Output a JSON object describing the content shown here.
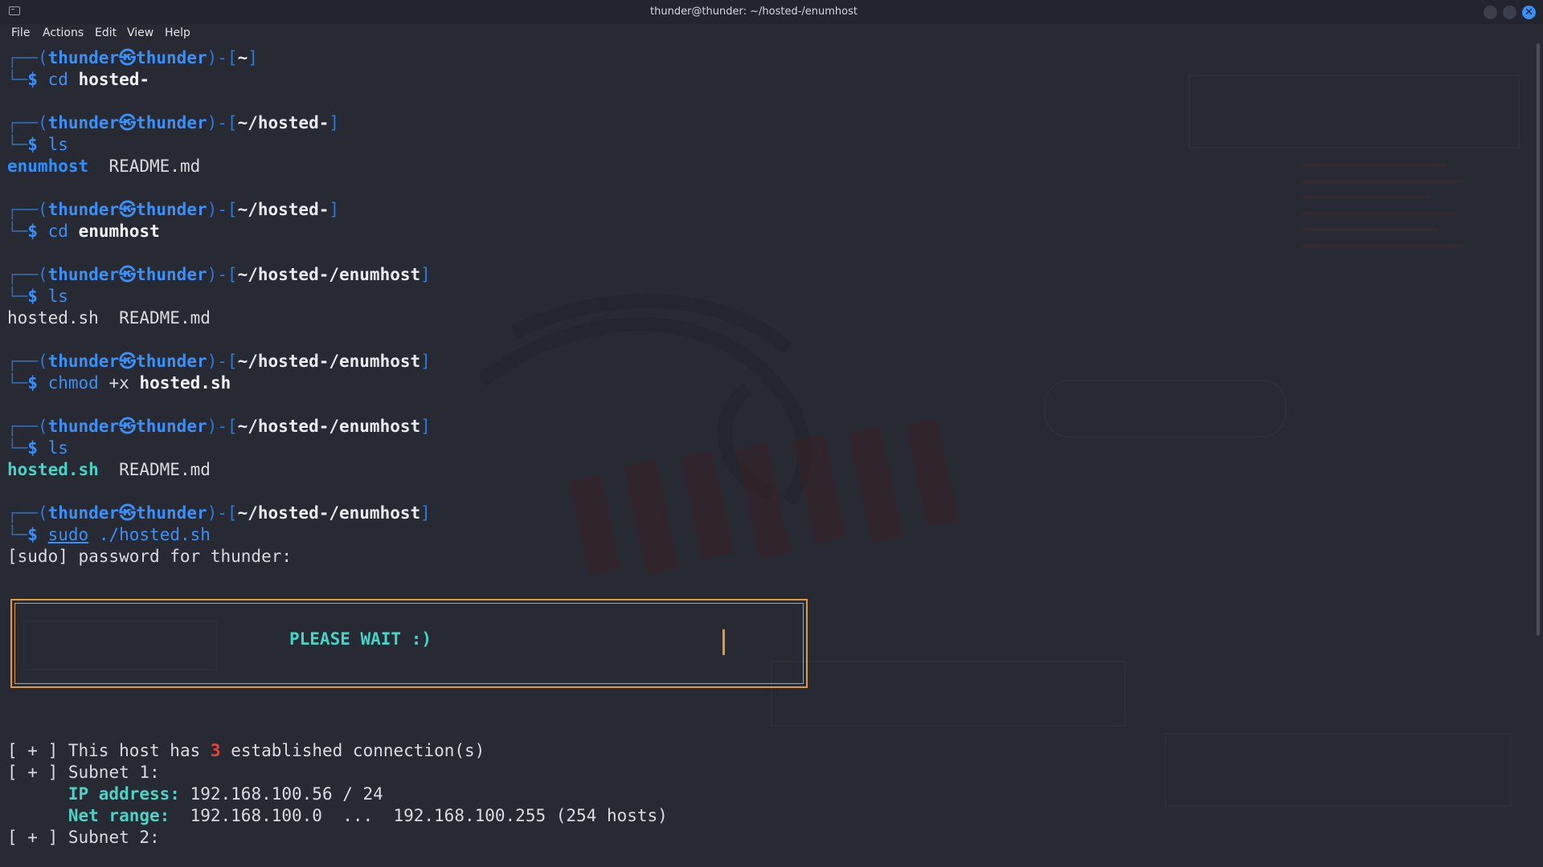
{
  "window": {
    "title": "thunder@thunder: ~/hosted-/enumhost"
  },
  "menu": {
    "items": [
      "File",
      "Actions",
      "Edit",
      "View",
      "Help"
    ]
  },
  "prompt": {
    "user": "thunder",
    "host": "thunder",
    "at_symbol": "㉿",
    "dollar": "$"
  },
  "blocks": [
    {
      "path": "~",
      "cmd": "cd",
      "args": "hosted-",
      "output": []
    },
    {
      "path": "~/hosted-",
      "cmd": "ls",
      "args": "",
      "output": [
        {
          "name": "enumhost",
          "kind": "dir"
        },
        {
          "name": "README.md",
          "kind": "file"
        }
      ]
    },
    {
      "path": "~/hosted-",
      "cmd": "cd",
      "args": "enumhost",
      "output": []
    },
    {
      "path": "~/hosted-/enumhost",
      "cmd": "ls",
      "args": "",
      "output": [
        {
          "name": "hosted.sh",
          "kind": "file"
        },
        {
          "name": "README.md",
          "kind": "file"
        }
      ]
    },
    {
      "path": "~/hosted-/enumhost",
      "cmd": "chmod",
      "args": "+x",
      "args2": "hosted.sh",
      "output": []
    },
    {
      "path": "~/hosted-/enumhost",
      "cmd": "ls",
      "args": "",
      "output": [
        {
          "name": "hosted.sh",
          "kind": "exec"
        },
        {
          "name": "README.md",
          "kind": "file"
        }
      ]
    },
    {
      "path": "~/hosted-/enumhost",
      "cmd": "sudo",
      "args": "./hosted.sh",
      "output": []
    }
  ],
  "sudo_prompt": "[sudo] password for thunder:",
  "wait_box": {
    "text": "PLEASE WAIT :)"
  },
  "report": {
    "marker": "[ + ]",
    "connections_prefix": "This host has",
    "connections_count": "3",
    "connections_suffix": "established connection(s)",
    "subnet1_label": "Subnet 1:",
    "ip_label": "IP address:",
    "ip_value": "192.168.100.56 / 24",
    "range_label": "Net range:",
    "range_value": "192.168.100.0  ...  192.168.100.255 (254 hosts)",
    "subnet2_label": "Subnet 2:"
  },
  "colors": {
    "background": "#272a33",
    "prompt_blue": "#3d8ff5",
    "accent_teal": "#45d4c6",
    "box_orange": "#e19a36",
    "alert_red": "#e0453a"
  }
}
